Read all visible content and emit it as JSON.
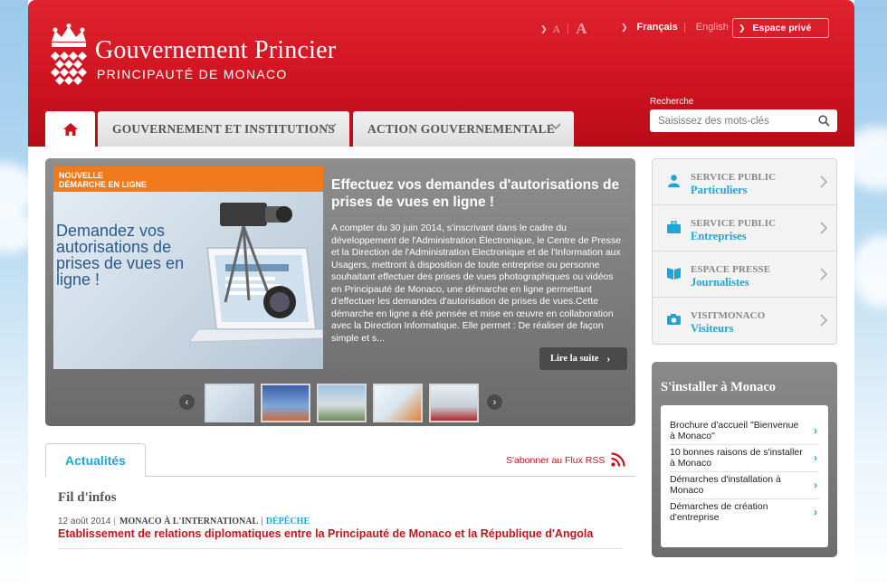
{
  "header": {
    "title": "Gouvernement Princier",
    "subtitle": "PRINCIPAUTÉ DE MONACO",
    "font_small": "A",
    "font_large": "A",
    "lang_fr": "Français",
    "lang_en": "English",
    "espace_prive": "Espace privé",
    "search_label": "Recherche",
    "search_placeholder": "Saisissez des mots-clés"
  },
  "nav": {
    "home_icon": "home-icon",
    "tabs": [
      {
        "label": "GOUVERNEMENT ET INSTITUTIONS"
      },
      {
        "label": "ACTION GOUVERNEMENTALE"
      }
    ]
  },
  "slider": {
    "badge_line1": "NOUVELLE",
    "badge_line2": "DÉMARCHE EN LIGNE",
    "image_headline": "Demandez vos autorisations de prises de vues en ligne !",
    "title": "Effectuez vos demandes d'autorisations de prises de vues en ligne !",
    "text": "A compter du 30 juin 2014, s'inscrivant dans le cadre du développement de l'Administration Électronique, le Centre de Presse et la Direction de l'Administration Electronique et de l'Information aux Usagers, mettront à disposition de toute entreprise ou personne souhaitant effectuer des prises de vues photographiques ou vidéos en Principauté de Monaco, une démarche en ligne permettant d'effectuer les demandes d'autorisation de prises de vues.Cette démarche en ligne a été pensée et mise en œuvre en collaboration avec la Direction Informatique. Elle permet : De réaliser de façon simple et s...",
    "read_more": "Lire la suite",
    "thumb_count": 5,
    "active_thumb": 1
  },
  "services": [
    {
      "top": "SERVICE PUBLIC",
      "bottom": "Particuliers",
      "icon": "person-icon"
    },
    {
      "top": "SERVICE PUBLIC",
      "bottom": "Entreprises",
      "icon": "briefcase-icon"
    },
    {
      "top": "ESPACE PRESSE",
      "bottom": "Journalistes",
      "icon": "book-icon"
    },
    {
      "top": "VISITMONACO",
      "bottom": "Visiteurs",
      "icon": "camera-icon"
    }
  ],
  "installer": {
    "title": "S'installer à Monaco",
    "items": [
      "Brochure d'accueil \"Bienvenue à Monaco\"",
      "10 bonnes raisons de s'installer à Monaco",
      "Démarches d'installation à Monaco",
      "Démarches de création d'entreprise"
    ]
  },
  "news": {
    "tab": "Actualités",
    "rss": "S'abonner au Flux RSS",
    "section": "Fil d'infos",
    "date": "12 août 2014",
    "category": "MONACO À L'INTERNATIONAL",
    "type": "DÉPÊCHE",
    "headline": "Etablissement de relations diplomatiques entre la Principauté de Monaco et la République d'Angola"
  },
  "colors": {
    "brand_red": "#cf1320",
    "accent_blue": "#1fa5d8",
    "badge_orange": "#f17b1c"
  }
}
